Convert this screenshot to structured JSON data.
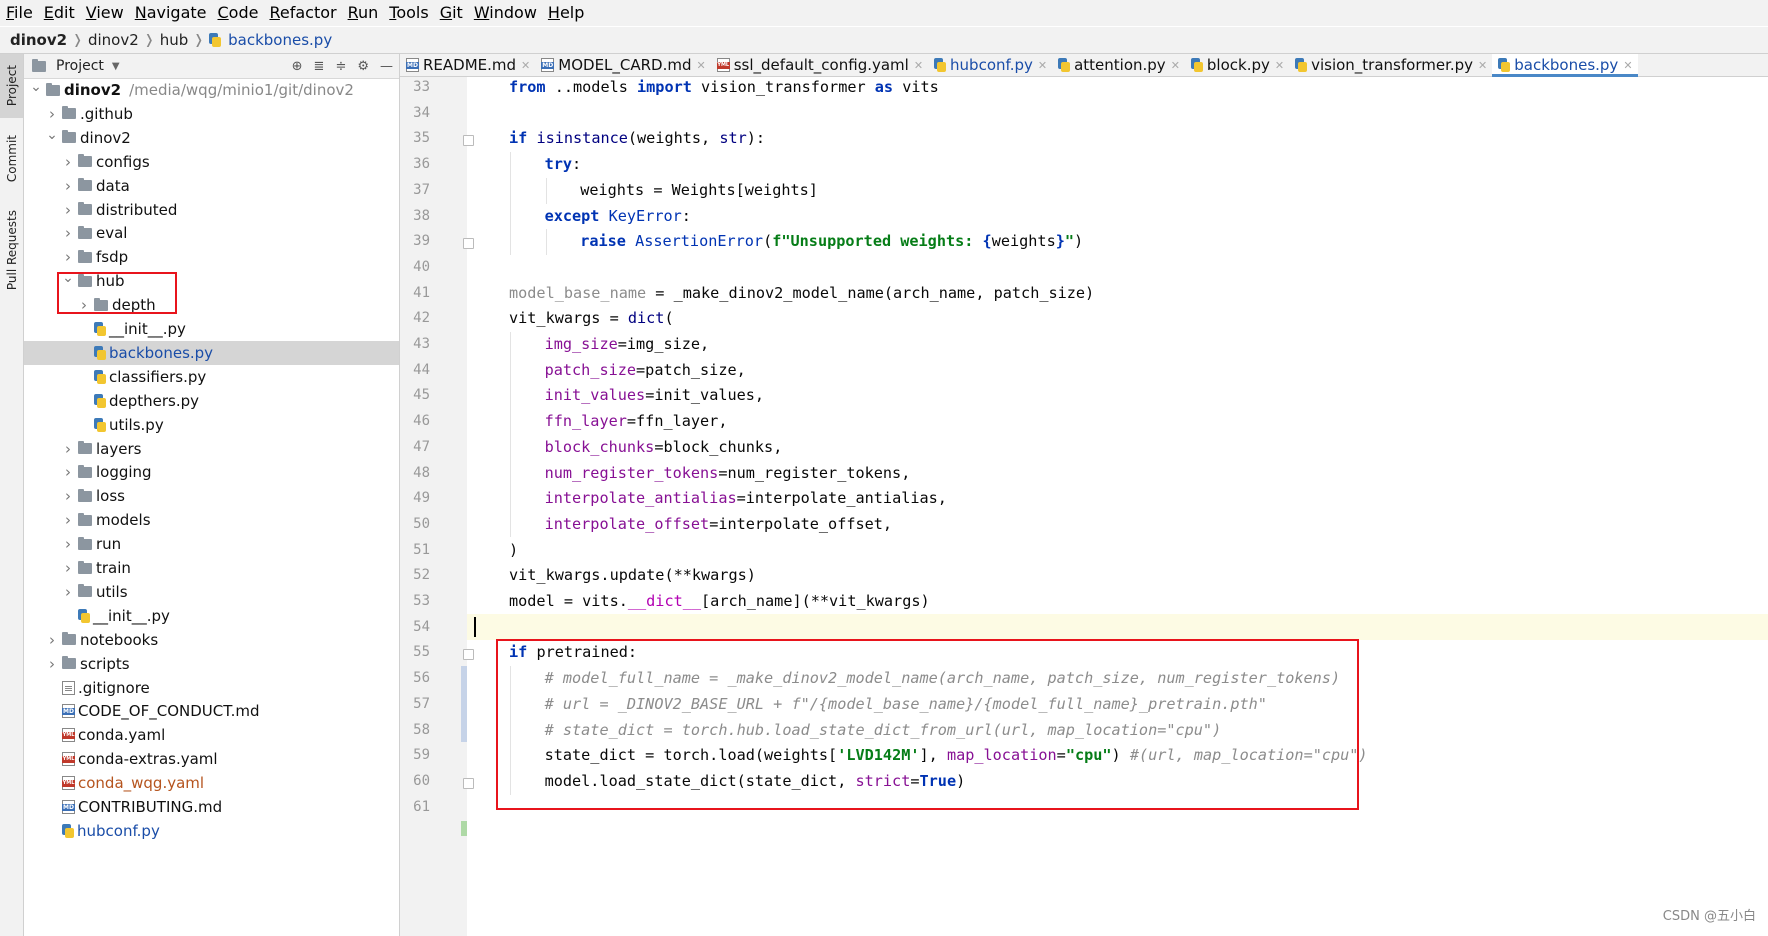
{
  "menubar": [
    {
      "label": "File",
      "mnemonic": "F",
      "rest": "ile"
    },
    {
      "label": "Edit",
      "mnemonic": "E",
      "rest": "dit"
    },
    {
      "label": "View",
      "mnemonic": "V",
      "rest": "iew"
    },
    {
      "label": "Navigate",
      "mnemonic": "N",
      "rest": "avigate"
    },
    {
      "label": "Code",
      "mnemonic": "C",
      "rest": "ode"
    },
    {
      "label": "Refactor",
      "mnemonic": "R",
      "rest": "efactor"
    },
    {
      "label": "Run",
      "mnemonic": "R",
      "rest": "un"
    },
    {
      "label": "Tools",
      "mnemonic": "T",
      "rest": "ools"
    },
    {
      "label": "Git",
      "mnemonic": "G",
      "rest": "it"
    },
    {
      "label": "Window",
      "mnemonic": "W",
      "rest": "indow"
    },
    {
      "label": "Help",
      "mnemonic": "H",
      "rest": "elp"
    }
  ],
  "breadcrumb": [
    "dinov2",
    "dinov2",
    "hub",
    "backbones.py"
  ],
  "toolstrip": {
    "project": "Project",
    "commit": "Commit",
    "pull": "Pull Requests"
  },
  "project_panel": {
    "title": "Project"
  },
  "tree": [
    {
      "name": "dinov2",
      "path": "/media/wqg/minio1/git/dinov2",
      "type": "folder",
      "depth": 0,
      "expanded": true,
      "bold": true
    },
    {
      "name": ".github",
      "type": "folder",
      "depth": 1,
      "expanded": false
    },
    {
      "name": "dinov2",
      "type": "folder",
      "depth": 1,
      "expanded": true
    },
    {
      "name": "configs",
      "type": "folder",
      "depth": 2,
      "expanded": false
    },
    {
      "name": "data",
      "type": "folder",
      "depth": 2,
      "expanded": false
    },
    {
      "name": "distributed",
      "type": "folder",
      "depth": 2,
      "expanded": false
    },
    {
      "name": "eval",
      "type": "folder",
      "depth": 2,
      "expanded": false
    },
    {
      "name": "fsdp",
      "type": "folder",
      "depth": 2,
      "expanded": false
    },
    {
      "name": "hub",
      "type": "folder",
      "depth": 2,
      "expanded": true
    },
    {
      "name": "depth",
      "type": "folder",
      "depth": 3,
      "expanded": false
    },
    {
      "name": "__init__.py",
      "type": "py",
      "depth": 3
    },
    {
      "name": "backbones.py",
      "type": "py",
      "depth": 3,
      "selected": true
    },
    {
      "name": "classifiers.py",
      "type": "py",
      "depth": 3
    },
    {
      "name": "depthers.py",
      "type": "py",
      "depth": 3
    },
    {
      "name": "utils.py",
      "type": "py",
      "depth": 3
    },
    {
      "name": "layers",
      "type": "folder",
      "depth": 2,
      "expanded": false
    },
    {
      "name": "logging",
      "type": "folder",
      "depth": 2,
      "expanded": false
    },
    {
      "name": "loss",
      "type": "folder",
      "depth": 2,
      "expanded": false
    },
    {
      "name": "models",
      "type": "folder",
      "depth": 2,
      "expanded": false
    },
    {
      "name": "run",
      "type": "folder",
      "depth": 2,
      "expanded": false
    },
    {
      "name": "train",
      "type": "folder",
      "depth": 2,
      "expanded": false
    },
    {
      "name": "utils",
      "type": "folder",
      "depth": 2,
      "expanded": false
    },
    {
      "name": "__init__.py",
      "type": "py",
      "depth": 2
    },
    {
      "name": "notebooks",
      "type": "folder",
      "depth": 1,
      "expanded": false
    },
    {
      "name": "scripts",
      "type": "folder",
      "depth": 1,
      "expanded": false
    },
    {
      "name": ".gitignore",
      "type": "file",
      "depth": 1
    },
    {
      "name": "CODE_OF_CONDUCT.md",
      "type": "md",
      "depth": 1
    },
    {
      "name": "conda.yaml",
      "type": "yml",
      "depth": 1
    },
    {
      "name": "conda-extras.yaml",
      "type": "yml",
      "depth": 1
    },
    {
      "name": "conda_wqg.yaml",
      "type": "yml",
      "depth": 1,
      "color": "brown"
    },
    {
      "name": "CONTRIBUTING.md",
      "type": "md",
      "depth": 1
    },
    {
      "name": "hubconf.py",
      "type": "py",
      "depth": 1,
      "color": "blue"
    }
  ],
  "editor_tabs": [
    {
      "label": "README.md",
      "type": "md"
    },
    {
      "label": "MODEL_CARD.md",
      "type": "md"
    },
    {
      "label": "ssl_default_config.yaml",
      "type": "yml"
    },
    {
      "label": "hubconf.py",
      "type": "py",
      "color": "blue"
    },
    {
      "label": "attention.py",
      "type": "py"
    },
    {
      "label": "block.py",
      "type": "py"
    },
    {
      "label": "vision_transformer.py",
      "type": "py"
    },
    {
      "label": "backbones.py",
      "type": "py",
      "active": true
    }
  ],
  "code_lines": [
    {
      "n": "33",
      "html": "<span class=\"kw\">from</span> ..models <span class=\"kw\">import</span> vision_transformer <span class=\"kw\">as</span> vits",
      "indent": 0
    },
    {
      "n": "34",
      "html": "",
      "indent": 0
    },
    {
      "n": "35",
      "html": "<span class=\"kw\">if</span> <span class=\"builtin\">isinstance</span>(weights, <span class=\"builtin\">str</span>):",
      "indent": 0
    },
    {
      "n": "36",
      "html": "<span class=\"kw\">try</span>:",
      "indent": 1
    },
    {
      "n": "37",
      "html": "weights = Weights[weights]",
      "indent": 2
    },
    {
      "n": "38",
      "html": "<span class=\"kw\">except</span> <span class=\"kwn\">KeyError</span>:",
      "indent": 1
    },
    {
      "n": "39",
      "html": "<span class=\"kw\">raise</span> <span class=\"kwn\">AssertionError</span>(<span class=\"str\">f\"Unsupported weights: </span><span class=\"kw\">{</span>weights<span class=\"kw\">}</span><span class=\"str\">\"</span>)",
      "indent": 2
    },
    {
      "n": "40",
      "html": "",
      "indent": 0
    },
    {
      "n": "41",
      "html": "<span class=\"unused\">model_base_name</span> = _make_dinov2_model_name(arch_name, patch_size)",
      "indent": 0
    },
    {
      "n": "42",
      "html": "vit_kwargs = <span class=\"builtin\">dict</span>(",
      "indent": 0
    },
    {
      "n": "43",
      "html": "<span class=\"param\">img_size</span>=img_size,",
      "indent": 1
    },
    {
      "n": "44",
      "html": "<span class=\"param\">patch_size</span>=patch_size,",
      "indent": 1
    },
    {
      "n": "45",
      "html": "<span class=\"param\">init_values</span>=init_values,",
      "indent": 1
    },
    {
      "n": "46",
      "html": "<span class=\"param\">ffn_layer</span>=ffn_layer,",
      "indent": 1
    },
    {
      "n": "47",
      "html": "<span class=\"param\">block_chunks</span>=block_chunks,",
      "indent": 1
    },
    {
      "n": "48",
      "html": "<span class=\"param\">num_register_tokens</span>=num_register_tokens,",
      "indent": 1
    },
    {
      "n": "49",
      "html": "<span class=\"param\">interpolate_antialias</span>=interpolate_antialias,",
      "indent": 1
    },
    {
      "n": "50",
      "html": "<span class=\"param\">interpolate_offset</span>=interpolate_offset,",
      "indent": 1
    },
    {
      "n": "51",
      "html": ")",
      "indent": 0
    },
    {
      "n": "52",
      "html": "vit_kwargs.update(**kwargs)",
      "indent": 0
    },
    {
      "n": "53",
      "html": "model = vits.<span class=\"dunder\">__dict__</span>[arch_name](**vit_kwargs)",
      "indent": 0
    },
    {
      "n": "54",
      "html": "",
      "indent": 0
    },
    {
      "n": "55",
      "html": "<span class=\"kw\">if</span> pretrained:",
      "indent": 0
    },
    {
      "n": "56",
      "html": "<span class=\"cmt\"># model_full_name = _make_dinov2_model_name(arch_name, patch_size, num_register_tokens)</span>",
      "indent": 1
    },
    {
      "n": "57",
      "html": "<span class=\"cmt\"># url = _DINOV2_BASE_URL + f\"/{model_base_name}/{model_full_name}_pretrain.pth\"</span>",
      "indent": 1
    },
    {
      "n": "58",
      "html": "<span class=\"cmt\"># state_dict = torch.hub.load_state_dict_from_url(url, map_location=\"cpu\")</span>",
      "indent": 1
    },
    {
      "n": "59",
      "html": "state_dict = torch.load(weights[<span class=\"str\">'LVD142M'</span>], <span class=\"param\">map_location</span>=<span class=\"str\">\"cpu\"</span>) <span class=\"cmt\">#(url, map_location=\"cpu\")</span>",
      "indent": 1
    },
    {
      "n": "60",
      "html": "model.load_state_dict(state_dict, <span class=\"param\">strict</span>=<span class=\"kw\">True</span>)",
      "indent": 1
    },
    {
      "n": "61",
      "html": "",
      "indent": 0
    }
  ],
  "watermark": "CSDN @五小白"
}
